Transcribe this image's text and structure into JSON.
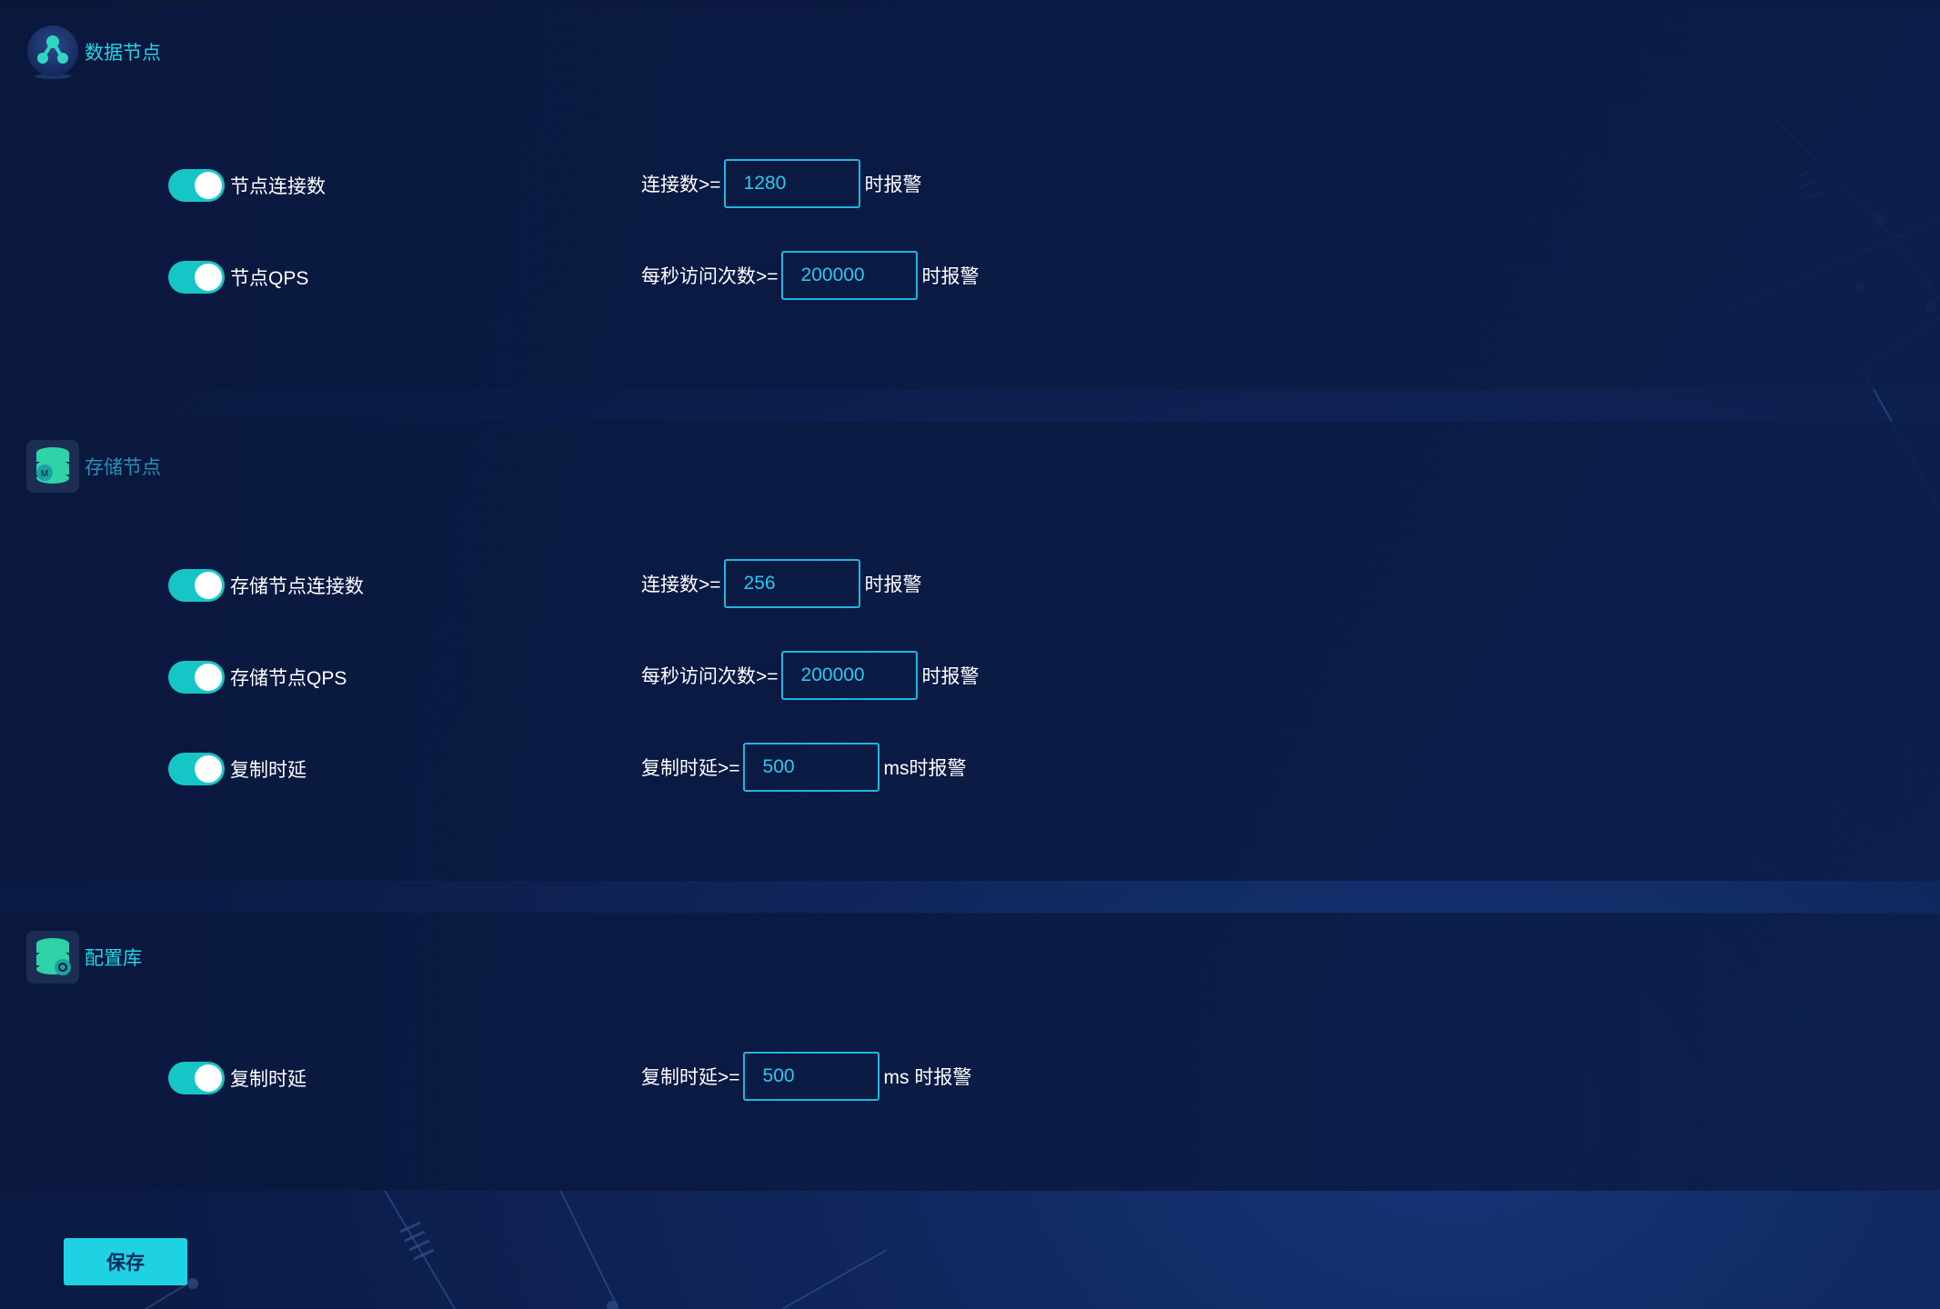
{
  "colors": {
    "accent": "#1ed2e4",
    "toggle_on": "#16c6c7",
    "input_border": "#1fb6e0",
    "background": "#0b1a43"
  },
  "sections": [
    {
      "title": "数据节点",
      "icon": "network-nodes-icon",
      "rows": [
        {
          "enabled": true,
          "label": "节点连接数",
          "prefix": "连接数>=",
          "value": "1280",
          "suffix": "时报警"
        },
        {
          "enabled": true,
          "label": "节点QPS",
          "prefix": "每秒访问次数>=",
          "value": "200000",
          "suffix": "时报警"
        }
      ]
    },
    {
      "title": "存储节点",
      "icon": "database-master-icon",
      "rows": [
        {
          "enabled": true,
          "label": "存储节点连接数",
          "prefix": "连接数>=",
          "value": "256",
          "suffix": "时报警"
        },
        {
          "enabled": true,
          "label": "存储节点QPS",
          "prefix": "每秒访问次数>=",
          "value": "200000",
          "suffix": "时报警"
        },
        {
          "enabled": true,
          "label": "复制时延",
          "prefix": "复制时延>=",
          "value": "500",
          "suffix": "ms时报警"
        }
      ]
    },
    {
      "title": "配置库",
      "icon": "database-config-icon",
      "rows": [
        {
          "enabled": true,
          "label": "复制时延",
          "prefix": "复制时延>=",
          "value": "500",
          "suffix": "ms 时报警"
        }
      ]
    }
  ],
  "save_label": "保存"
}
